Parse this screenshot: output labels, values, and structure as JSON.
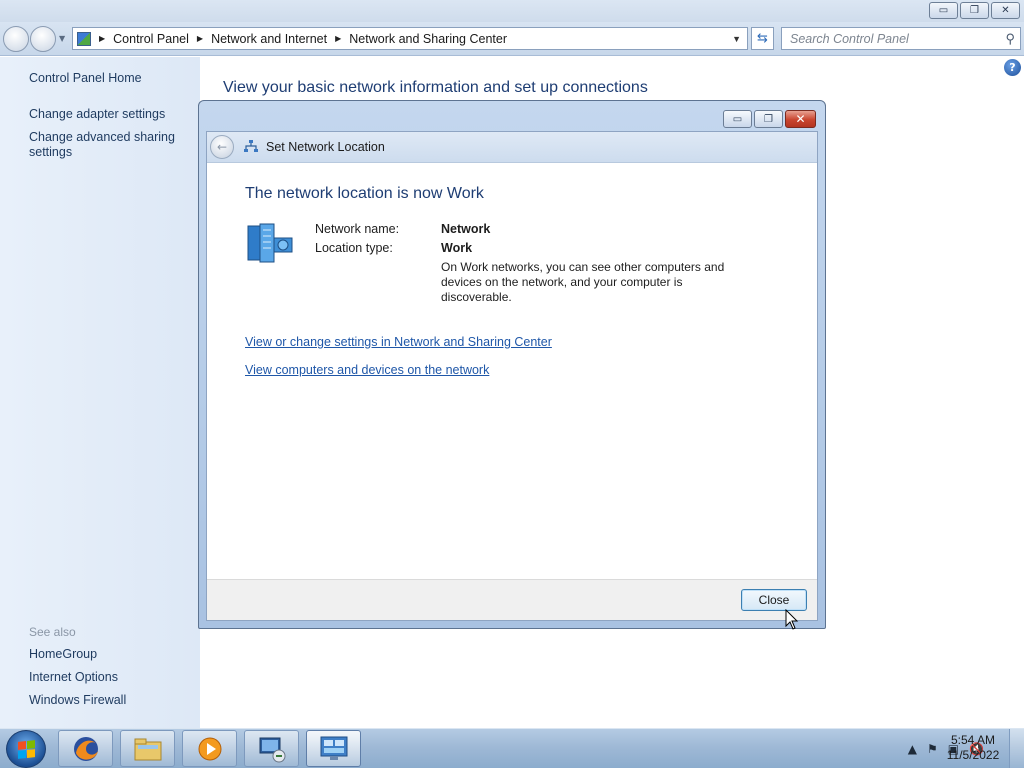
{
  "window": {
    "minimize_glyph": "▭",
    "maximize_glyph": "❐",
    "close_glyph": "✕"
  },
  "address_bar": {
    "breadcrumbs": [
      "Control Panel",
      "Network and Internet",
      "Network and Sharing Center"
    ],
    "search_placeholder": "Search Control Panel"
  },
  "left_pane": {
    "home": "Control Panel Home",
    "links": [
      "Change adapter settings",
      "Change advanced sharing settings"
    ],
    "see_also_heading": "See also",
    "see_also": [
      "HomeGroup",
      "Internet Options",
      "Windows Firewall"
    ]
  },
  "main": {
    "title": "View your basic network information and set up connections",
    "help_glyph": "?"
  },
  "dialog": {
    "title": "Set Network Location",
    "heading": "The network location is now Work",
    "network_name_label": "Network name:",
    "network_name_value": "Network",
    "location_type_label": "Location type:",
    "location_type_value": "Work",
    "description": "On Work networks, you can see other computers and devices on the network, and your computer is discoverable.",
    "link_settings": "View or change settings in Network and Sharing Center",
    "link_devices": "View computers and devices on the network",
    "close_button": "Close"
  },
  "taskbar": {
    "time": "5:54 AM",
    "date": "11/5/2022",
    "items": [
      "firefox-icon",
      "explorer-icon",
      "media-player-icon",
      "network-monitor-icon",
      "control-panel-icon"
    ]
  }
}
